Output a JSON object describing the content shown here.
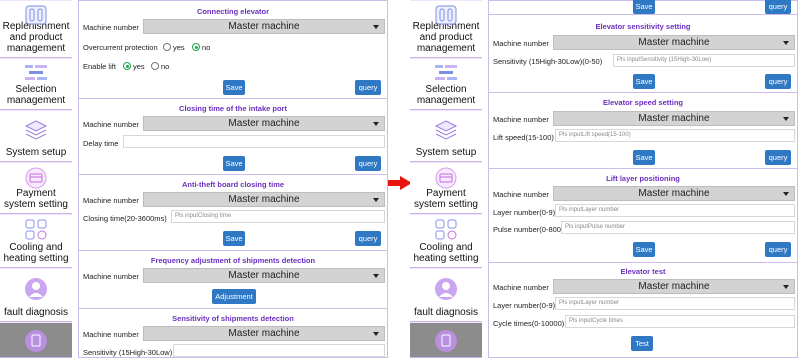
{
  "sidebar": {
    "items": [
      {
        "label": "Replenishment and product management",
        "icon": "product-icon"
      },
      {
        "label": "Selection management",
        "icon": "selection-icon"
      },
      {
        "label": "System setup",
        "icon": "layers-icon"
      },
      {
        "label": "Payment system setting",
        "icon": "card-icon"
      },
      {
        "label": "Cooling and heating setting",
        "icon": "grid-gear-icon"
      },
      {
        "label": "fault diagnosis",
        "icon": "person-icon"
      }
    ]
  },
  "left": {
    "s1": {
      "title": "Connecting elevator",
      "machine_label": "Machine number",
      "machine_value": "Master machine",
      "overcurrent_label": "Overcurrent protection",
      "yes": "yes",
      "no": "no",
      "enable_label": "Enable lift",
      "save": "Save",
      "query": "query"
    },
    "s2": {
      "title": "Closing time of the intake port",
      "machine_label": "Machine number",
      "machine_value": "Master machine",
      "delay_label": "Delay time",
      "save": "Save",
      "query": "query"
    },
    "s3": {
      "title": "Anti-theft board closing time",
      "machine_label": "Machine number",
      "machine_value": "Master machine",
      "closing_label": "Closing time(20-3600ms)",
      "closing_ph": "Pls inputClosing time",
      "save": "Save",
      "query": "query"
    },
    "s4": {
      "title": "Frequency adjustment of shipments detection",
      "machine_label": "Machine number",
      "machine_value": "Master machine",
      "adjust": "Adjustment"
    },
    "s5": {
      "title": "Sensitivity of shipments detection",
      "machine_label": "Machine number",
      "machine_value": "Master machine",
      "sens_label": "Sensitivity (15High-30Low)"
    }
  },
  "right": {
    "top": {
      "save": "Save",
      "query": "query"
    },
    "s1": {
      "title": "Elevator sensitivity setting",
      "machine_label": "Machine number",
      "machine_value": "Master machine",
      "sens_label": "Sensitivity (15High-30Low)(0-50)",
      "sens_ph": "Pls inputSensitivity (15High-30Low)",
      "save": "Save",
      "query": "query"
    },
    "s2": {
      "title": "Elevator speed setting",
      "machine_label": "Machine number",
      "machine_value": "Master machine",
      "speed_label": "Lift speed(15-100)",
      "speed_ph": "Pls inputLift speed(15-100)",
      "save": "Save",
      "query": "query"
    },
    "s3": {
      "title": "Lift layer positioning",
      "machine_label": "Machine number",
      "machine_value": "Master machine",
      "layer_label": "Layer number(0-9)",
      "layer_ph": "Pls inputLayer number",
      "pulse_label": "Pulse number(0-8000)",
      "pulse_ph": "Pls inputPulse number",
      "save": "Save",
      "query": "query"
    },
    "s4": {
      "title": "Elevator test",
      "machine_label": "Machine number",
      "machine_value": "Master machine",
      "layer_label": "Layer number(0-9)",
      "layer_ph": "Pls inputLayer number",
      "cycle_label": "Cycle times(0-10000)",
      "cycle_ph": "Pls inputCycle times",
      "test": "Test"
    }
  },
  "colors": {
    "accent": "#2f78c4",
    "title": "#6b2fbf",
    "arrow": "#e8140f"
  }
}
